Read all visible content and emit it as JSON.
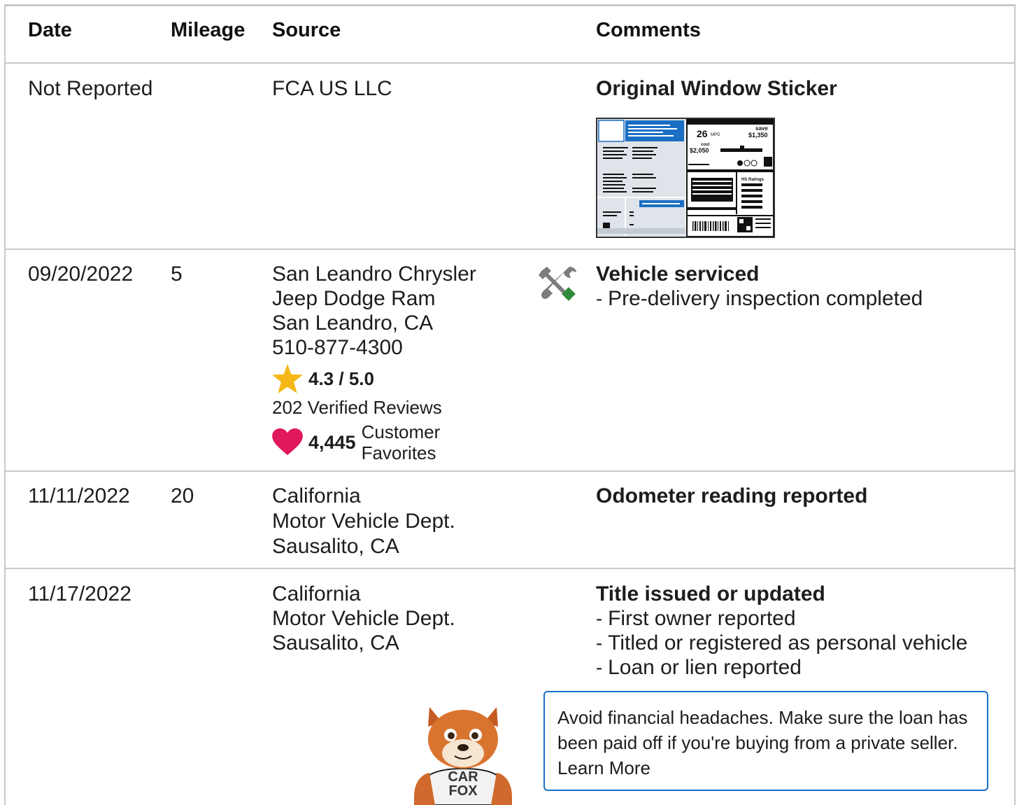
{
  "headers": {
    "date": "Date",
    "mileage": "Mileage",
    "source": "Source",
    "comments": "Comments"
  },
  "rows": [
    {
      "date": "Not Reported",
      "mileage": "",
      "source": [
        "FCA US LLC"
      ],
      "comment_title": "Original Window Sticker",
      "comment_lines": [],
      "sticker": {
        "mpg": "26",
        "mpg_unit": "MPG",
        "save_label": "save",
        "save_amount": "$1,350",
        "cost_label": "cost",
        "cost_amount": "$2,050",
        "ratings_label": "HS Ratings"
      }
    },
    {
      "date": "09/20/2022",
      "mileage": "5",
      "source": [
        "San Leandro Chrysler",
        "Jeep Dodge Ram",
        "San Leandro, CA",
        "510-877-4300"
      ],
      "rating": "4.3 / 5.0",
      "reviews": "202 Verified Reviews",
      "favorites_count": "4,445",
      "favorites_label_1": "Customer",
      "favorites_label_2": "Favorites",
      "comment_title": "Vehicle serviced",
      "comment_lines": [
        "Pre-delivery inspection completed"
      ],
      "icon": "service-tools-icon"
    },
    {
      "date": "11/11/2022",
      "mileage": "20",
      "source": [
        "California",
        "Motor Vehicle Dept.",
        "Sausalito, CA"
      ],
      "comment_title": "Odometer reading reported",
      "comment_lines": []
    },
    {
      "date": "11/17/2022",
      "mileage": "",
      "source": [
        "California",
        "Motor Vehicle Dept.",
        "Sausalito, CA"
      ],
      "comment_title": "Title issued or updated",
      "comment_lines": [
        "First owner reported",
        "Titled or registered as personal vehicle",
        "Loan or lien reported"
      ],
      "tip": "Avoid financial headaches. Make sure the loan has been paid off if you're buying from a private seller.",
      "tip_link": "Learn More",
      "mascot_shirt_1": "CAR",
      "mascot_shirt_2": "FOX"
    }
  ],
  "colors": {
    "border": "#c8c8c8",
    "star": "#f5b819",
    "heart": "#e0185e",
    "tip_border": "#1a6fc4",
    "tool_green": "#2e8b3a",
    "tool_gray": "#7d7d7d"
  }
}
